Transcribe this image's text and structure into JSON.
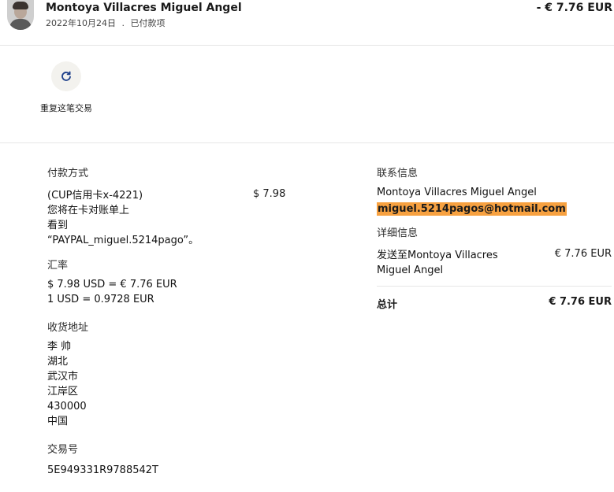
{
  "header": {
    "name": "Montoya Villacres Miguel Angel",
    "date": "2022年10月24日",
    "separator": ".",
    "status": "已付款项",
    "amount": "- € 7.76 EUR"
  },
  "actions": {
    "repeat_label": "重复这笔交易"
  },
  "payment_method": {
    "title": "付款方式",
    "card": "(CUP信用卡x-4221)",
    "amount": "$ 7.98",
    "note_line1": "您将在卡对账单上",
    "note_line2": "看到",
    "note_line3": "“PAYPAL_miguel.5214pago”。"
  },
  "exchange": {
    "title": "汇率",
    "line1": "$ 7.98 USD = € 7.76 EUR",
    "line2": "1 USD = 0.9728 EUR"
  },
  "shipping": {
    "title": "收货地址",
    "lines": [
      "李 帅",
      "湖北",
      "武汉市",
      "江岸区",
      "430000",
      "中国"
    ]
  },
  "transaction": {
    "title": "交易号",
    "id": "5E949331R9788542T"
  },
  "contact": {
    "title": "联系信息",
    "name": "Montoya Villacres Miguel Angel",
    "email": "miguel.5214pagos@hotmail.com"
  },
  "details": {
    "title": "详细信息",
    "line1": "发送至Montoya Villacres",
    "line2": "Miguel Angel",
    "amount": "€ 7.76 EUR"
  },
  "total": {
    "label": "总计",
    "amount": "€ 7.76 EUR"
  },
  "colors": {
    "highlight": "#f7a140",
    "icon_blue": "#1d3f8a"
  }
}
